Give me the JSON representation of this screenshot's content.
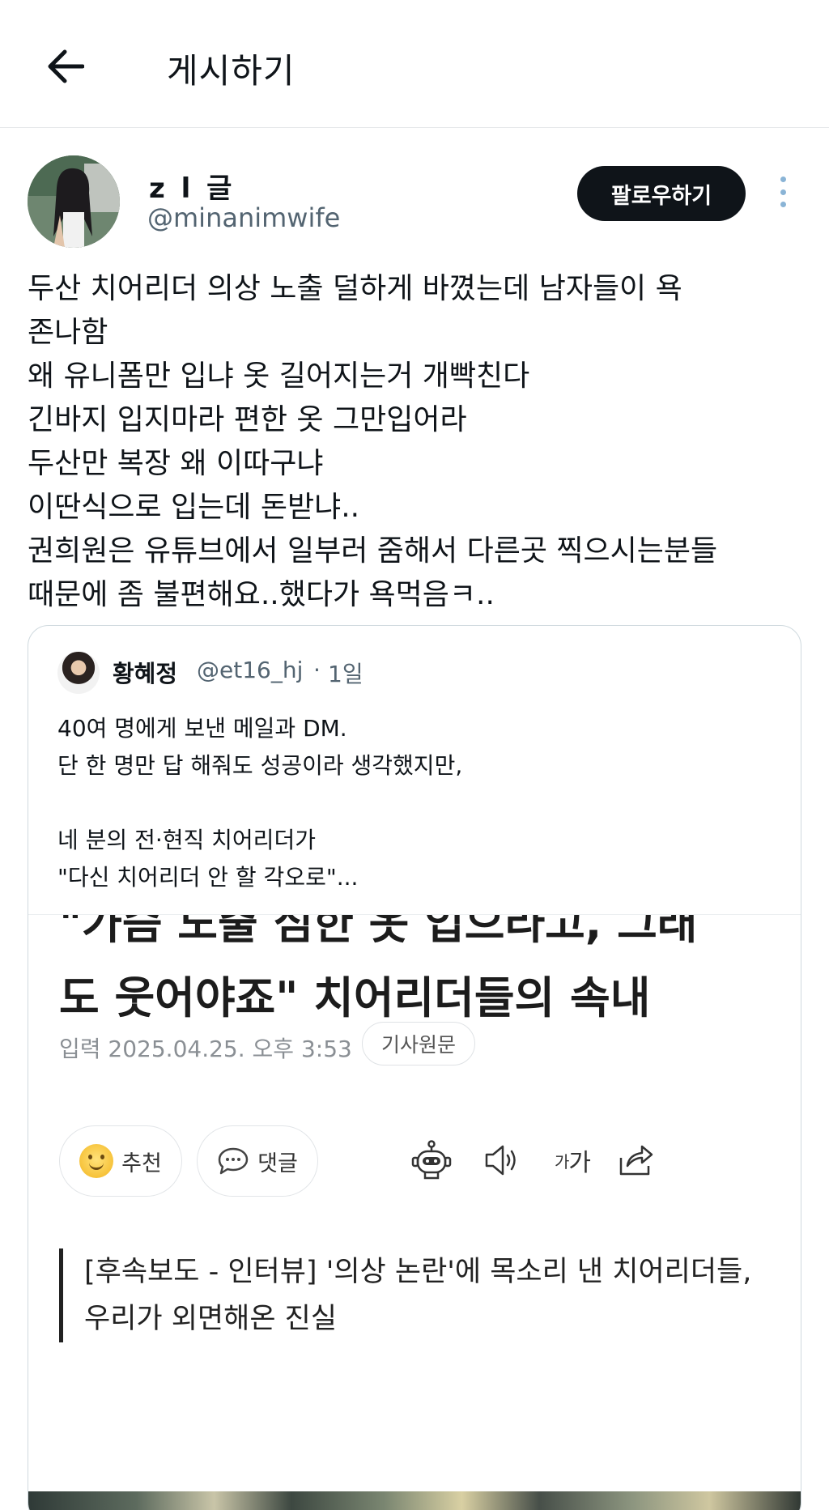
{
  "header": {
    "back_icon": "arrow-left-icon",
    "title": "게시하기"
  },
  "post": {
    "author": {
      "display_name": "z l 글",
      "handle": "@minanimwife"
    },
    "follow_label": "팔로우하기",
    "more_icon": "more-vertical-icon",
    "text": "두산 치어리더 의상 노출 덜하게 바꼈는데 남자들이 욕\n존나함\n왜 유니폼만 입냐 옷 길어지는거 개빡친다\n긴바지 입지마라 편한 옷 그만입어라\n두산만 복장 왜 이따구냐\n이딴식으로 입는데 돈받냐..\n권희원은 유튜브에서 일부러 줌해서 다른곳 찍으시는분들\n때문에 좀 불편해요..했다가 욕먹음ㅋ.."
  },
  "quote": {
    "author_name": "황혜정",
    "handle": "@et16_hj",
    "separator": "·",
    "time": "1일",
    "text": "40여 명에게 보낸 메일과 DM.\n단 한 명만 답 해줘도 성공이라 생각했지만,\n\n네 분의 전·현직 치어리더가\n\"다신 치어리더 안 할 각오로\"...",
    "article": {
      "headline_line1": "\"가슴 노출 심한 옷 입으라고, 그래",
      "headline_line2": "도 웃어야죠\" 치어리더들의 속내",
      "date": "입력 2025.04.25. 오후 3:53",
      "original_button": "기사원문",
      "recommend_label": "추천",
      "comment_label": "댓글",
      "font_size_big": "가",
      "font_size_small": "가",
      "summary": "[후속보도 - 인터뷰] '의상 논란'에 목소리 낸 치어리더들, 우리가 외면해온 진실"
    }
  }
}
